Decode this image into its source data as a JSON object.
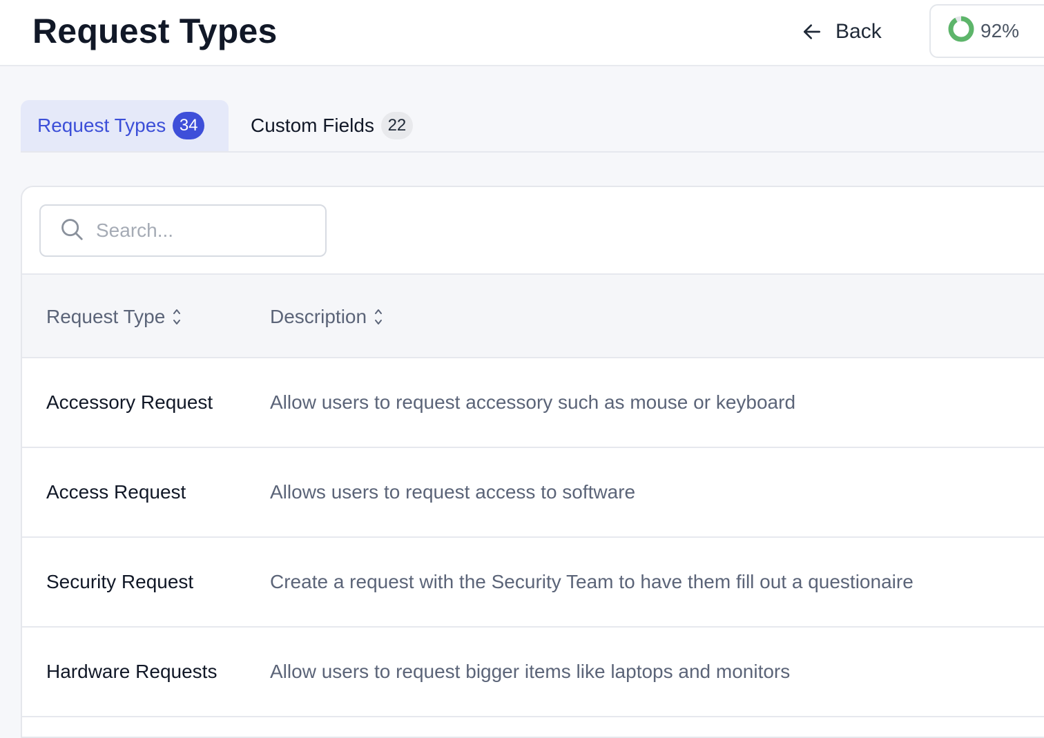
{
  "header": {
    "title": "Request Types",
    "back_label": "Back",
    "progress_label": "92%",
    "progress_value": 0.92,
    "progress_color": "#5db56a"
  },
  "tabs": [
    {
      "label": "Request Types",
      "count": "34",
      "active": true
    },
    {
      "label": "Custom Fields",
      "count": "22",
      "active": false
    }
  ],
  "search": {
    "placeholder": "Search...",
    "value": "",
    "icon": "search-icon"
  },
  "table": {
    "columns": [
      {
        "label": "Request Type",
        "icon": "sort-icon"
      },
      {
        "label": "Description",
        "icon": "sort-icon"
      }
    ],
    "rows": [
      {
        "name": "Accessory Request",
        "description": "Allow users to request accessory such as mouse or keyboard"
      },
      {
        "name": "Access Request",
        "description": "Allows users to request access to software"
      },
      {
        "name": "Security Request",
        "description": "Create a request with the Security Team to have them fill out a questionaire"
      },
      {
        "name": "Hardware Requests",
        "description": "Allow users to request bigger items like laptops and monitors"
      }
    ]
  },
  "colors": {
    "accent": "#3e4fd9",
    "accent_bg": "#e5e9f9"
  }
}
